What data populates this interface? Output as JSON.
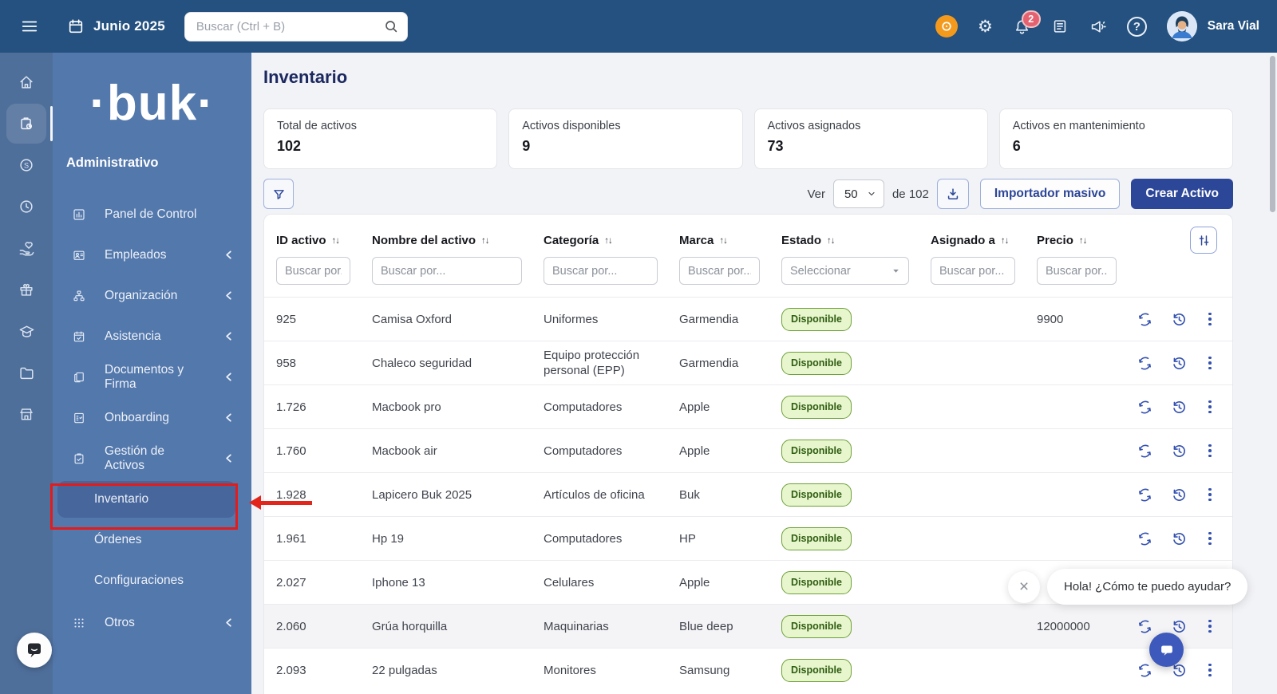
{
  "topbar": {
    "date": "Junio 2025",
    "search_placeholder": "Buscar (Ctrl + B)",
    "notification_count": "2",
    "user_name": "Sara Vial"
  },
  "sidebar": {
    "logo": "·buk·",
    "profile": "Administrativo",
    "items": [
      {
        "label": "Panel de Control"
      },
      {
        "label": "Empleados"
      },
      {
        "label": "Organización"
      },
      {
        "label": "Asistencia"
      },
      {
        "label": "Documentos y Firma"
      },
      {
        "label": "Onboarding"
      },
      {
        "label": "Gestión de Activos"
      }
    ],
    "subitems": [
      {
        "label": "Inventario"
      },
      {
        "label": "Órdenes"
      },
      {
        "label": "Configuraciones"
      }
    ],
    "otros_label": "Otros"
  },
  "page": {
    "title": "Inventario",
    "cards": [
      {
        "label": "Total de activos",
        "value": "102"
      },
      {
        "label": "Activos disponibles",
        "value": "9"
      },
      {
        "label": "Activos asignados",
        "value": "73"
      },
      {
        "label": "Activos en mantenimiento",
        "value": "6"
      }
    ],
    "toolbar": {
      "ver_label": "Ver",
      "page_size": "50",
      "of_label": "de 102",
      "import_button": "Importador masivo",
      "create_button": "Crear Activo"
    }
  },
  "table": {
    "columns": [
      "ID activo",
      "Nombre del activo",
      "Categoría",
      "Marca",
      "Estado",
      "Asignado a",
      "Precio"
    ],
    "filters": {
      "id_placeholder": "Buscar por..",
      "name_placeholder": "Buscar por...",
      "category_placeholder": "Buscar por...",
      "brand_placeholder": "Buscar por...",
      "status_placeholder": "Seleccionar",
      "assigned_placeholder": "Buscar por...",
      "price_placeholder": "Buscar por.."
    },
    "rows": [
      {
        "id": "925",
        "name": "Camisa Oxford",
        "category": "Uniformes",
        "brand": "Garmendia",
        "status": "Disponible",
        "assigned": "",
        "price": "9900"
      },
      {
        "id": "958",
        "name": "Chaleco seguridad",
        "category": "Equipo protección personal (EPP)",
        "brand": "Garmendia",
        "status": "Disponible",
        "assigned": "",
        "price": ""
      },
      {
        "id": "1.726",
        "name": "Macbook pro",
        "category": "Computadores",
        "brand": "Apple",
        "status": "Disponible",
        "assigned": "",
        "price": ""
      },
      {
        "id": "1.760",
        "name": "Macbook air",
        "category": "Computadores",
        "brand": "Apple",
        "status": "Disponible",
        "assigned": "",
        "price": ""
      },
      {
        "id": "1.928",
        "name": "Lapicero Buk 2025",
        "category": "Artículos de oficina",
        "brand": "Buk",
        "status": "Disponible",
        "assigned": "",
        "price": ""
      },
      {
        "id": "1.961",
        "name": "Hp 19",
        "category": "Computadores",
        "brand": "HP",
        "status": "Disponible",
        "assigned": "",
        "price": ""
      },
      {
        "id": "2.027",
        "name": "Iphone 13",
        "category": "Celulares",
        "brand": "Apple",
        "status": "Disponible",
        "assigned": "",
        "price": ""
      },
      {
        "id": "2.060",
        "name": "Grúa horquilla",
        "category": "Maquinarias",
        "brand": "Blue deep",
        "status": "Disponible",
        "assigned": "",
        "price": "12000000",
        "highlighted": true
      },
      {
        "id": "2.093",
        "name": "22 pulgadas",
        "category": "Monitores",
        "brand": "Samsung",
        "status": "Disponible",
        "assigned": "",
        "price": ""
      }
    ]
  },
  "chat": {
    "greeting": "Hola! ¿Cómo te puedo ayudar?"
  },
  "ui": {
    "gear_icon": "⚙",
    "help_icon": "?",
    "sort_icon": "↑↓",
    "close_icon": "×"
  },
  "colors": {
    "topbar_bg": "#24517f",
    "rail_bg": "#4f6f9b",
    "sidebar_bg": "#5378ac",
    "accent_blue": "#2c4698",
    "badge_green_bg": "#e7f6cd",
    "badge_green_border": "#6da039",
    "badge_green_text": "#2f5d12",
    "annotation_red": "#e31b1b",
    "notification_red": "#e4626f",
    "support_orange": "#f39a1d"
  }
}
